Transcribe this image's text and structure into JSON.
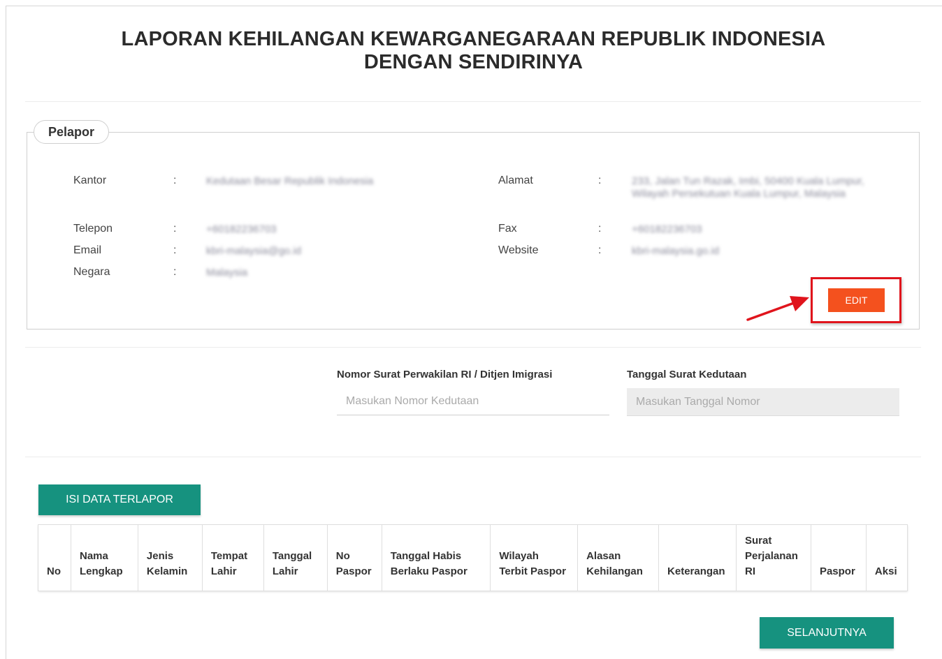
{
  "page": {
    "title": "LAPORAN KEHILANGAN KEWARGANEGARAAN REPUBLIK INDONESIA DENGAN SENDIRINYA"
  },
  "pelapor": {
    "legend": "Pelapor",
    "colon": ":",
    "fields": {
      "kantor": {
        "label": "Kantor",
        "value": "Kedutaan Besar Republik Indonesia"
      },
      "telepon": {
        "label": "Telepon",
        "value": "+60182236703"
      },
      "email": {
        "label": "Email",
        "value": "kbri-malaysia@go.id"
      },
      "negara": {
        "label": "Negara",
        "value": "Malaysia"
      },
      "alamat": {
        "label": "Alamat",
        "value": "233, Jalan Tun Razak, Imbi, 50400 Kuala Lumpur, Wilayah Persekutuan Kuala Lumpur, Malaysia"
      },
      "fax": {
        "label": "Fax",
        "value": "+60182236703"
      },
      "website": {
        "label": "Website",
        "value": "kbri-malaysia.go.id"
      }
    },
    "edit_label": "EDIT"
  },
  "form": {
    "nomor_surat": {
      "label": "Nomor Surat Perwakilan RI / Ditjen Imigrasi",
      "placeholder": "Masukan Nomor Kedutaan"
    },
    "tanggal_surat": {
      "label": "Tanggal Surat Kedutaan",
      "placeholder": "Masukan Tanggal Nomor"
    }
  },
  "terlapor": {
    "isi_data_label": "ISI DATA TERLAPOR",
    "columns": {
      "no": "No",
      "nama_lengkap": "Nama Lengkap",
      "jenis_kelamin": "Jenis Kelamin",
      "tempat_lahir": "Tempat Lahir",
      "tanggal_lahir": "Tanggal Lahir",
      "no_paspor": "No Paspor",
      "tanggal_habis": "Tanggal Habis Berlaku Paspor",
      "wilayah_terbit": "Wilayah Terbit Paspor",
      "alasan_kehilangan": "Alasan Kehilangan",
      "keterangan": "Keterangan",
      "surat_perjalanan": "Surat Perjalanan RI",
      "paspor": "Paspor",
      "aksi": "Aksi"
    }
  },
  "footer": {
    "next_label": "SELANJUTNYA"
  },
  "colors": {
    "accent_teal": "#16927f",
    "edit_orange": "#f4511e",
    "highlight_red": "#e0141c"
  }
}
